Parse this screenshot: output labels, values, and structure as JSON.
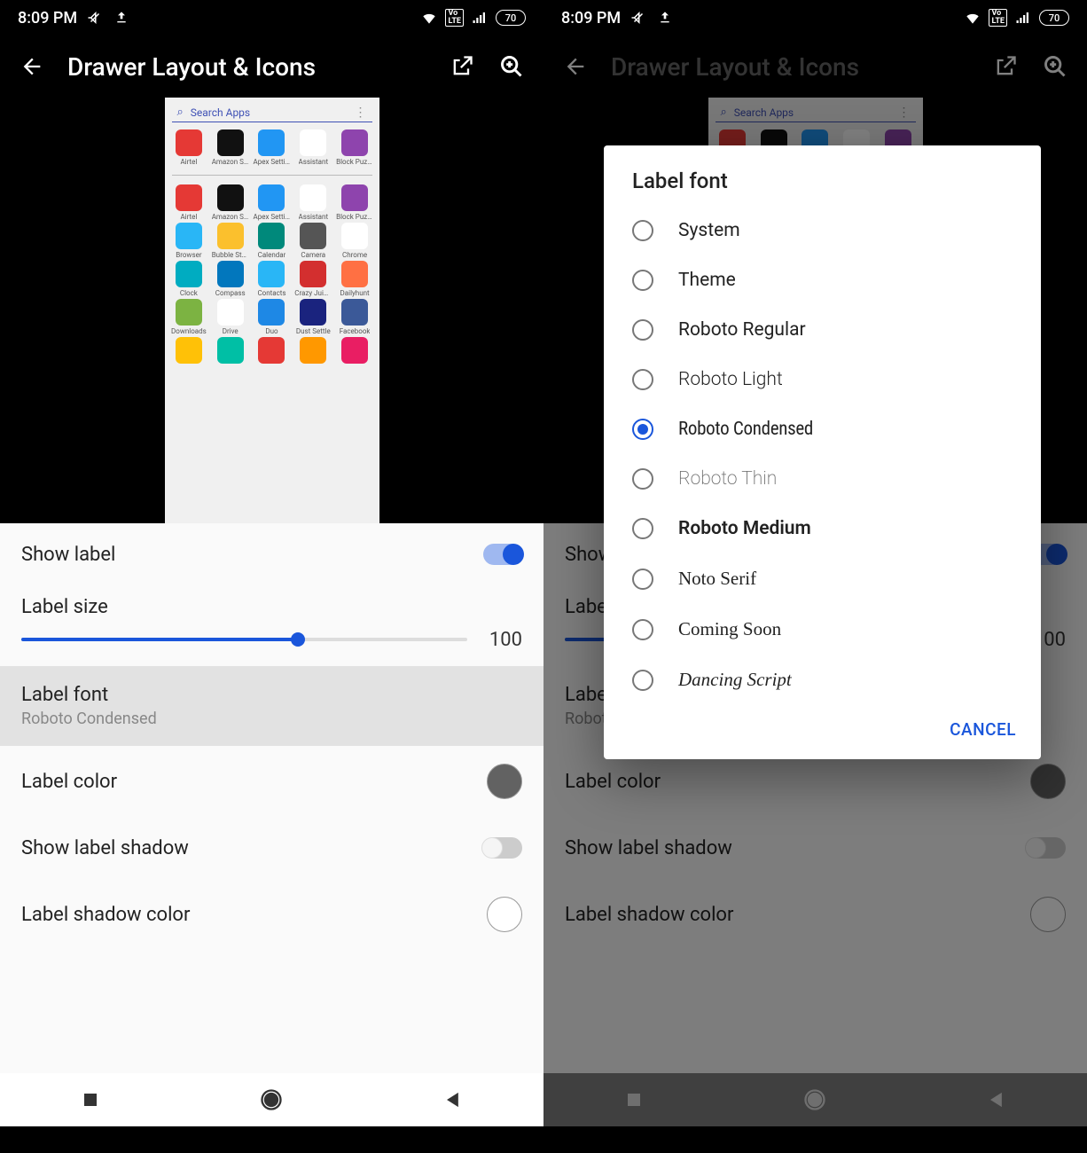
{
  "status": {
    "time": "8:09 PM",
    "battery": "70"
  },
  "appbar": {
    "title": "Drawer Layout & Icons"
  },
  "preview": {
    "search": "Search Apps",
    "apps_r1": [
      "Airtel",
      "Amazon Sh..",
      "Apex Settin..",
      "Assistant",
      "Block Puzzl.."
    ],
    "apps_r2": [
      "Airtel",
      "Amazon Sh..",
      "Apex Settin..",
      "Assistant",
      "Block Puzzl.."
    ],
    "apps_r3": [
      "Browser",
      "Bubble Story",
      "Calendar",
      "Camera",
      "Chrome"
    ],
    "apps_r4": [
      "Clock",
      "Compass",
      "Contacts",
      "Crazy Juicer",
      "Dailyhunt"
    ],
    "apps_r5": [
      "Downloads",
      "Drive",
      "Duo",
      "Dust Settle",
      "Facebook"
    ],
    "icon_colors_r1": [
      "#e53935",
      "#111",
      "#2196f3",
      "#fff",
      "#8e44ad"
    ],
    "icon_colors_r2": [
      "#e53935",
      "#111",
      "#2196f3",
      "#fff",
      "#8e44ad"
    ],
    "icon_colors_r3": [
      "#29b6f6",
      "#fbc02d",
      "#00897b",
      "#555",
      "#fff"
    ],
    "icon_colors_r4": [
      "#00acc1",
      "#0277bd",
      "#29b6f6",
      "#d32f2f",
      "#ff7043"
    ],
    "icon_colors_r5": [
      "#7cb342",
      "#fff",
      "#1e88e5",
      "#1a237e",
      "#3b5998"
    ],
    "icon_colors_r6": [
      "#ffc107",
      "#00bfa5",
      "#e53935",
      "#ff9800",
      "#e91e63"
    ]
  },
  "settings": {
    "show_label": "Show label",
    "label_size": "Label size",
    "label_size_val": "100",
    "label_font": "Label font",
    "label_font_val": "Roboto Condensed",
    "label_color": "Label color",
    "show_shadow": "Show label shadow",
    "shadow_color": "Label shadow color",
    "color_swatch_1": "#626262",
    "color_swatch_2": "#ffffff"
  },
  "dialog": {
    "title": "Label font",
    "options": [
      {
        "label": "System",
        "cls": ""
      },
      {
        "label": "Theme",
        "cls": ""
      },
      {
        "label": "Roboto Regular",
        "cls": ""
      },
      {
        "label": "Roboto Light",
        "cls": "f-light"
      },
      {
        "label": "Roboto Condensed",
        "cls": "f-condensed"
      },
      {
        "label": "Roboto Thin",
        "cls": "f-thin"
      },
      {
        "label": "Roboto Medium",
        "cls": "f-med"
      },
      {
        "label": "Noto Serif",
        "cls": "f-serif"
      },
      {
        "label": "Coming Soon",
        "cls": "f-cursive"
      },
      {
        "label": "Dancing Script",
        "cls": "f-script"
      }
    ],
    "selected": 4,
    "cancel": "CANCEL"
  }
}
